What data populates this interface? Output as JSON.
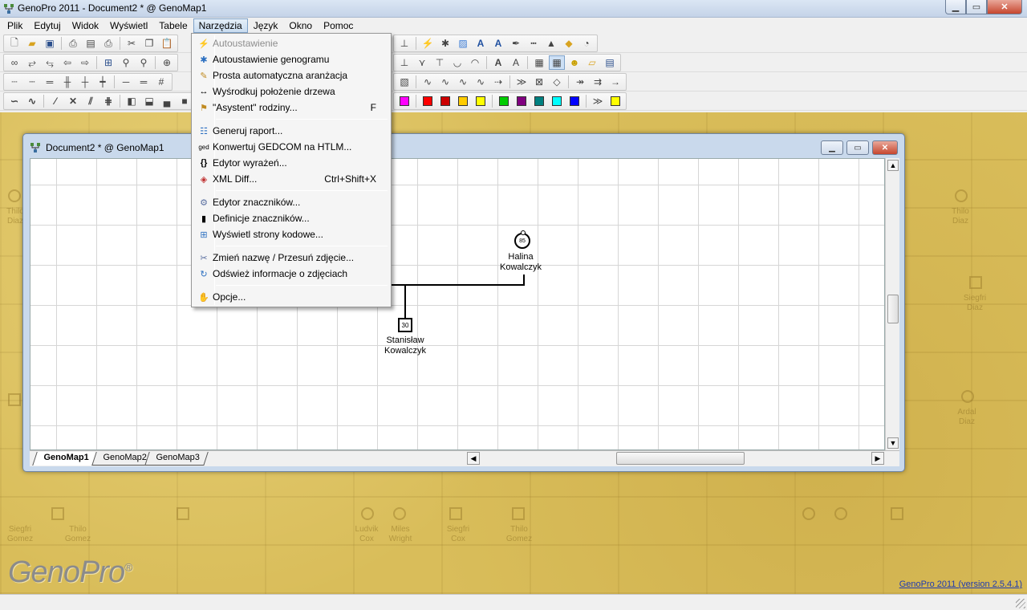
{
  "app": {
    "title": "GenoPro 2011 - Document2 * @ GenoMap1",
    "window_buttons": {
      "minimize": "▁",
      "maximize": "▭",
      "close": "✕"
    }
  },
  "menubar": {
    "items": [
      "Plik",
      "Edytuj",
      "Widok",
      "Wyświetl",
      "Tabele",
      "Narzędzia",
      "Język",
      "Okno",
      "Pomoc"
    ],
    "active": "Narzędzia"
  },
  "dropdown": {
    "items": [
      {
        "label": "Autoustawienie",
        "shortcut": "",
        "icon": "auto-layout-icon",
        "glyph": "⚡",
        "disabled": true
      },
      {
        "label": "Autoustawienie genogramu",
        "shortcut": "",
        "icon": "auto-layout-genogram-icon",
        "glyph": "✱",
        "disabled": false
      },
      {
        "label": "Prosta automatyczna aranżacja",
        "shortcut": "",
        "icon": "simple-arrange-icon",
        "glyph": "✎",
        "disabled": false
      },
      {
        "label": "Wyśrodkuj położenie drzewa",
        "shortcut": "",
        "icon": "center-tree-icon",
        "glyph": "↔",
        "disabled": false
      },
      {
        "label": "\"Asystent\" rodziny...",
        "shortcut": "F",
        "icon": "family-wizard-icon",
        "glyph": "⚑",
        "disabled": false
      },
      {
        "label": "Generuj raport...",
        "shortcut": "",
        "icon": "report-icon",
        "glyph": "☷",
        "disabled": false
      },
      {
        "label": "Konwertuj GEDCOM na HTLM...",
        "shortcut": "",
        "icon": "gedcom-icon",
        "glyph": "ged",
        "disabled": false
      },
      {
        "label": "Edytor wyrażeń...",
        "shortcut": "",
        "icon": "expression-editor-icon",
        "glyph": "{}",
        "disabled": false
      },
      {
        "label": "XML Diff...",
        "shortcut": "Ctrl+Shift+X",
        "icon": "xml-diff-icon",
        "glyph": "◈",
        "disabled": false
      },
      {
        "label": "Edytor znaczników...",
        "shortcut": "",
        "icon": "tag-editor-icon",
        "glyph": "⚙",
        "disabled": false
      },
      {
        "label": "Definicje znaczników...",
        "shortcut": "",
        "icon": "tag-definitions-icon",
        "glyph": "▮",
        "disabled": false
      },
      {
        "label": "Wyświetl strony kodowe...",
        "shortcut": "",
        "icon": "code-pages-icon",
        "glyph": "⊞",
        "disabled": false
      },
      {
        "label": "Zmień nazwę / Przesuń zdjęcie...",
        "shortcut": "",
        "icon": "rename-picture-icon",
        "glyph": "✂",
        "disabled": false
      },
      {
        "label": "Odśwież informacje o zdjęciach",
        "shortcut": "",
        "icon": "refresh-pictures-icon",
        "glyph": "↻",
        "disabled": false
      },
      {
        "label": "Opcje...",
        "shortcut": "",
        "icon": "options-icon",
        "glyph": "✋",
        "disabled": false
      }
    ]
  },
  "document_window": {
    "title": "Document2 * @ GenoMap1",
    "tabs": [
      "GenoMap1",
      "GenoMap2",
      "GenoMap3"
    ],
    "selected_tab": "GenoMap1"
  },
  "genogram": {
    "partial_label": "yk",
    "people": [
      {
        "first": "Halina",
        "last": "Kowalczyk",
        "age": "85",
        "gender": "female"
      },
      {
        "first": "Stanisław",
        "last": "Kowalczyk",
        "age": "30",
        "gender": "male"
      }
    ]
  },
  "branding": {
    "logo": "GenoPro",
    "logo_mark": "®",
    "version_link": "GenoPro 2011 (version 2.5.4.1)"
  },
  "toolbar_colors": {
    "row4_swatches": [
      "#ff00ff",
      "#ff0000",
      "#cc0000",
      "#ffcc00",
      "#ffff00",
      "#00cc00",
      "#800080",
      "#008080",
      "#00ffff",
      "#0000ff",
      "#ffff00"
    ]
  },
  "ghost_names": [
    {
      "name": "Thilo",
      "surname": "Diaz"
    },
    {
      "name": "Siegfri",
      "surname": "Diaz"
    },
    {
      "name": "Ardal",
      "surname": "Diaz"
    },
    {
      "name": "Siegfri",
      "surname": "Gomez"
    },
    {
      "name": "Thilo",
      "surname": "Gomez"
    },
    {
      "name": "Ludvik",
      "surname": "Cox"
    },
    {
      "name": "Miles",
      "surname": "Wright"
    },
    {
      "name": "Siegfri",
      "surname": "Cox"
    },
    {
      "name": "Thilo",
      "surname": "Gomez"
    }
  ]
}
